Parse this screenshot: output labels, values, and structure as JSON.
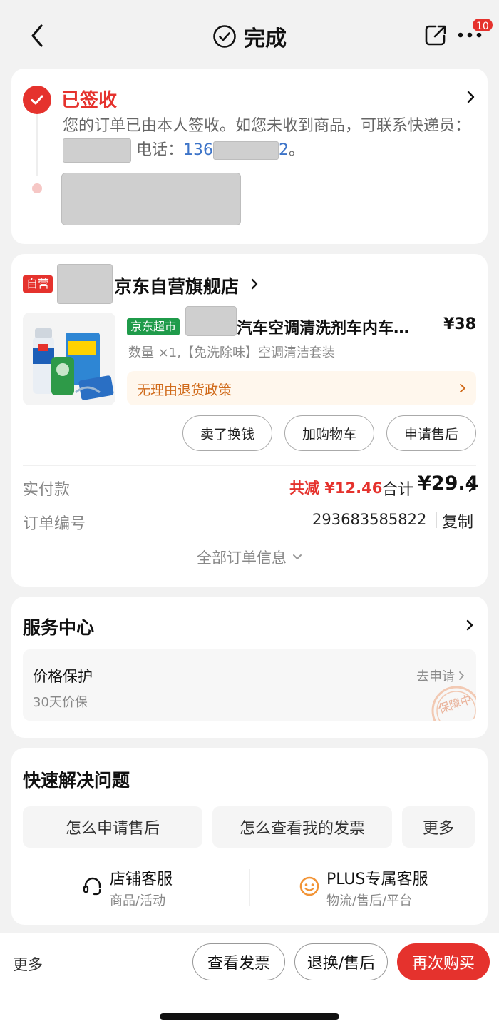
{
  "header": {
    "title": "完成",
    "badge_count": "10"
  },
  "delivery": {
    "status": "已签收",
    "desc_prefix": "您的订单已由本人签收。如您未收到商品，可联系快递员：",
    "phone_label": "电话：",
    "phone_start": "136",
    "phone_end": "2",
    "period": "。"
  },
  "order": {
    "self_badge": "自营",
    "store_name": "京东自营旗舰店",
    "product": {
      "badge": "京东超市",
      "title": "汽车空调清洗剂车内车…",
      "price": "¥38",
      "spec": "数量 ×1,【免洗除味】空调清洁套装",
      "policy": "无理由退货政策"
    },
    "buttons": {
      "sell": "卖了换钱",
      "cart": "加购物车",
      "after_sale": "申请售后"
    },
    "paid_label": "实付款",
    "discount": "共减 ¥12.46",
    "total_label": "合计",
    "total_value": "¥29.4",
    "order_no_label": "订单编号",
    "order_no": "293683585822",
    "copy": "复制",
    "all_info": "全部订单信息"
  },
  "service": {
    "title": "服务中心",
    "price_protect": "价格保护",
    "price_sub": "30天价保",
    "apply": "去申请",
    "stamp": "保障中"
  },
  "quick": {
    "title": "快速解决问题",
    "faq": [
      "怎么申请售后",
      "怎么查看我的发票",
      "更多"
    ],
    "store_cs_title": "店铺客服",
    "store_cs_sub": "商品/活动",
    "plus_cs_title": "PLUS专属客服",
    "plus_cs_sub": "物流/售后/平台"
  },
  "bottom": {
    "more": "更多",
    "invoice": "查看发票",
    "return": "退换/售后",
    "rebuy": "再次购买"
  },
  "colors": {
    "accent_red": "#e5322d",
    "phone_blue": "#3d74c8",
    "policy_orange": "#d06a1a",
    "super_green": "#1f9b4a"
  }
}
